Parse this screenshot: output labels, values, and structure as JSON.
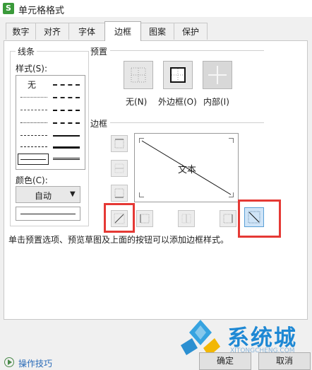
{
  "window": {
    "title": "单元格格式",
    "app_icon_glyph": "S"
  },
  "tabs": [
    {
      "label": "数字"
    },
    {
      "label": "对齐"
    },
    {
      "label": "字体"
    },
    {
      "label": "边框"
    },
    {
      "label": "图案"
    },
    {
      "label": "保护"
    }
  ],
  "active_tab": "边框",
  "line": {
    "section_label": "线条",
    "style_label": "样式(S):",
    "none_label": "无",
    "color_label": "颜色(C):",
    "color_value": "自动",
    "selected_style": "thin-solid"
  },
  "presets": {
    "section_label": "预置",
    "none_label": "无(N)",
    "outline_label": "外边框(O)",
    "inside_label": "内部(I)"
  },
  "border": {
    "section_label": "边框",
    "preview_text": "文本",
    "active_button": "diagonal-down-border-button",
    "preview_diagonal": "down"
  },
  "hint_text": "单击预置选项、预览草图及上面的按钮可以添加边框样式。",
  "footer": {
    "tips_label": "操作技巧",
    "ok_label": "确定",
    "cancel_label": "取消"
  },
  "watermark": {
    "brand": "系统城",
    "domain": "XITONGCHENG.COM"
  },
  "colors": {
    "highlight": "#e53935",
    "active_button_fill": "#cfe4f7",
    "active_button_border": "#5a9fd6",
    "tips_icon": "#4a8a4a"
  }
}
